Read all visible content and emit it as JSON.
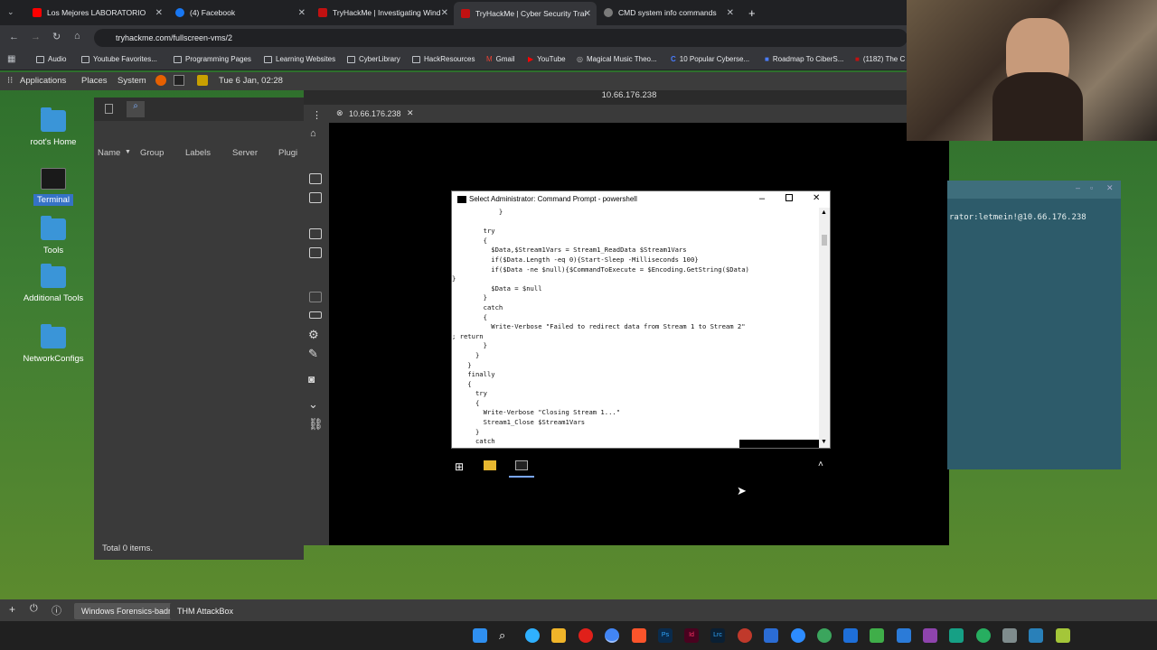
{
  "browser": {
    "tabs": [
      {
        "label": "Los Mejores LABORATORIO",
        "color": "#ff0000"
      },
      {
        "label": "(4) Facebook",
        "color": "#1877f2"
      },
      {
        "label": "TryHackMe | Investigating Wind",
        "color": "#c11111"
      },
      {
        "label": "TryHackMe | Cyber Security Trai",
        "color": "#c11111"
      },
      {
        "label": "CMD system info commands",
        "color": "#7a7a7a"
      }
    ],
    "new_tab": "+",
    "url": "tryhackme.com/fullscreen-vms/2",
    "bookmarks": [
      "Audio",
      "Youtube Favorites...",
      "Programming Pages",
      "Learning Websites",
      "CyberLibrary",
      "HackResources",
      "Gmail",
      "YouTube",
      "Magical Music Theo...",
      "10 Popular Cyberse...",
      "Roadmap To CiberS...",
      "(1182) The C"
    ]
  },
  "gnome": {
    "menus": [
      "Applications",
      "Places",
      "System"
    ],
    "clock": "Tue 6 Jan, 02:28"
  },
  "desktop_icons": [
    "root's Home",
    "Terminal",
    "Tools",
    "Additional Tools",
    "NetworkConfigs"
  ],
  "file_manager": {
    "columns": [
      "Name",
      "Group",
      "Labels",
      "Server",
      "Plugi"
    ],
    "status": "Total 0 items."
  },
  "remmina": {
    "title": "10.66.176.238",
    "tab_label": "10.66.176.238"
  },
  "cmd": {
    "title": "Select Administrator: Command Prompt - powershell",
    "lines": "            }\n\n        try\n        {\n          $Data,$Stream1Vars = Stream1_ReadData $Stream1Vars\n          if($Data.Length -eq 0){Start-Sleep -Milliseconds 100}\n          if($Data -ne $null){$CommandToExecute = $Encoding.GetString($Data)\n}\n          $Data = $null\n        }\n        catch\n        {\n          Write-Verbose \"Failed to redirect data from Stream 1 to Stream 2\"\n; return\n        }\n      }\n    }\n    finally\n    {\n      try\n      {\n        Write-Verbose \"Closing Stream 1...\"\n        Stream1_Close $Stream1Vars\n      }\n      catch"
  },
  "terminal2": {
    "text": "rator:letmein!@10.66.176.238"
  },
  "bottom": {
    "tasks": [
      "Windows Forensics-badr",
      "THM AttackBox"
    ]
  }
}
